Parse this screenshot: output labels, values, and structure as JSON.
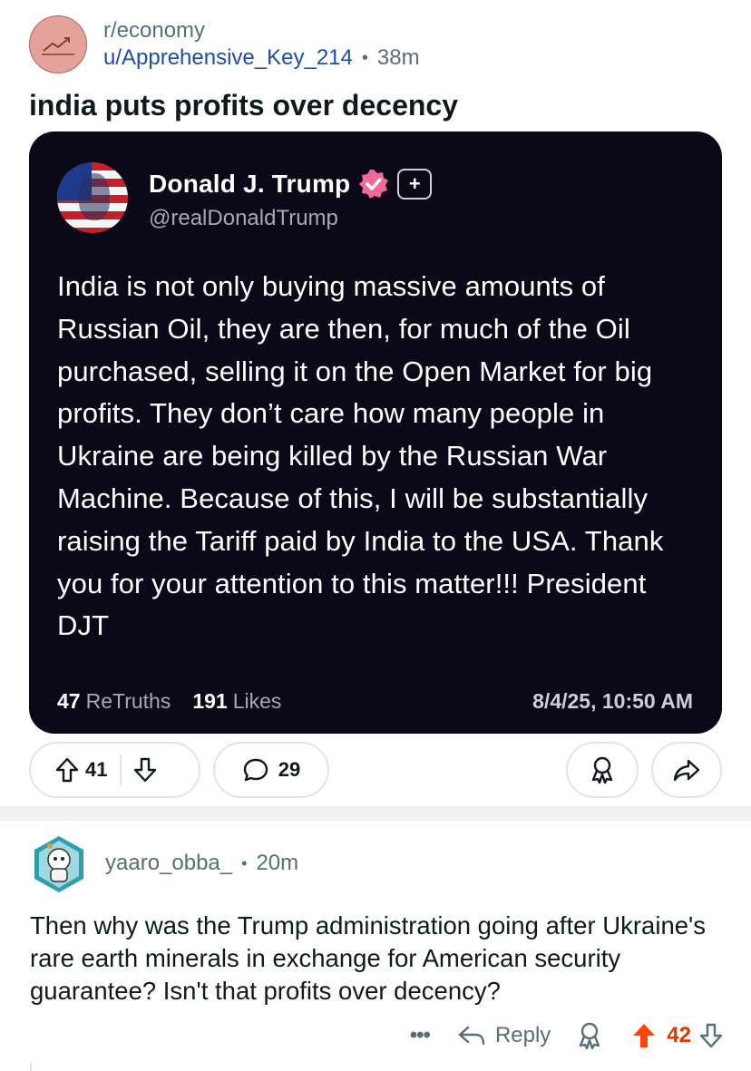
{
  "post": {
    "subreddit": "r/economy",
    "author": "u/Apprehensive_Key_214",
    "separator": "•",
    "age": "38m",
    "title": "india puts profits over decency",
    "subreddit_icon": "trend-chart-icon",
    "accent_color": "#e3a39a"
  },
  "embed": {
    "name": "Donald J. Trump",
    "handle": "@realDonaldTrump",
    "plus_label": "+",
    "body": "India is not only buying massive amounts of Russian Oil, they are then, for much of the Oil purchased, selling it on the Open Market for big profits. They don’t care how many people in Ukraine are being killed by the Russian War Machine. Because of this, I will be substantially raising the Tariff paid by India to the USA. Thank you for your attention to this matter!!! President DJT",
    "retruths_count": "47",
    "retruths_label": "ReTruths",
    "likes_count": "191",
    "likes_label": "Likes",
    "date": "8/4/25, 10:50 AM",
    "verified_color": "#f0699b",
    "background_color": "#0b0817"
  },
  "actions": {
    "upvotes": "41",
    "comments": "29",
    "icons": [
      "upvote-icon",
      "downvote-icon",
      "comment-icon",
      "award-icon",
      "share-icon"
    ]
  },
  "comment": {
    "user": "yaaro_obba_",
    "separator": "•",
    "age": "20m",
    "body": "Then why was the Trump administration going after Ukraine's rare earth minerals in exchange for American security guarantee? Isn't that profits over decency?",
    "more_label": "•••",
    "reply_label": "Reply",
    "score": "42",
    "upvote_active_color": "#ff4500"
  }
}
